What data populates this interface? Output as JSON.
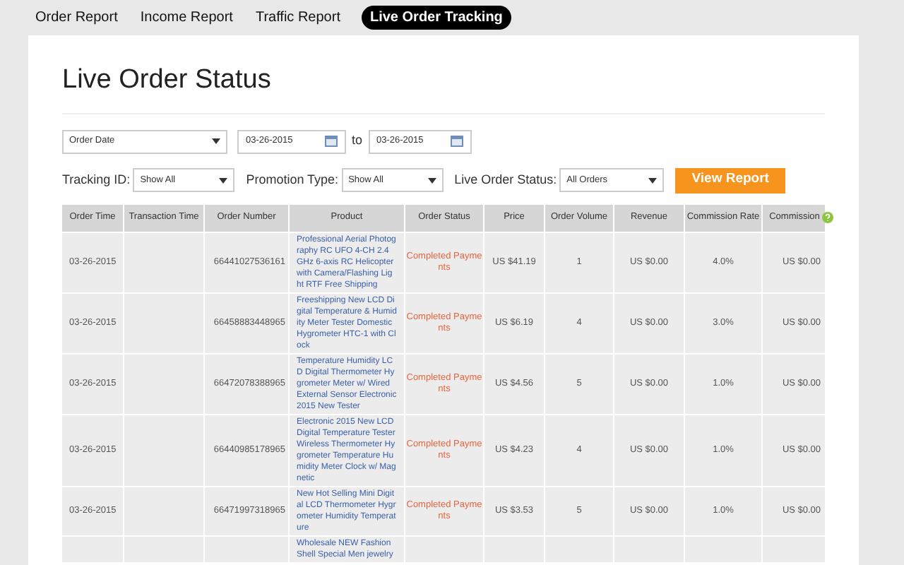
{
  "tabs": [
    {
      "label": "Order Report",
      "selected": false
    },
    {
      "label": "Income Report",
      "selected": false
    },
    {
      "label": "Traffic Report",
      "selected": false
    },
    {
      "label": "Live Order Tracking",
      "selected": true
    }
  ],
  "title": "Live Order Status",
  "date_filter": {
    "select": "Order Date",
    "from": "03-26-2015",
    "separator": "to",
    "to": "03-26-2015"
  },
  "filters": [
    {
      "label": "Tracking ID:",
      "value": "Show All"
    },
    {
      "label": "Promotion Type:",
      "value": "Show All"
    },
    {
      "label": "Live Order Status:",
      "value": "All Orders"
    }
  ],
  "view_button": "View Report",
  "table": {
    "columns": [
      "Order Time",
      "Transaction Time",
      "Order Number",
      "Product",
      "Order Status",
      "Price",
      "Order Volume",
      "Revenue",
      "Commission Rate",
      "Commission"
    ],
    "rows": [
      {
        "order_time": "03-26-2015",
        "order_number": "66441027536161",
        "product": "Professional Aerial Photography RC UFO 4-CH 2.4 GHz 6-axis RC Helicopter with Camera/Flashing Light RTF Free Shipping",
        "status": "Completed Payments",
        "price": "US $41.19",
        "volume": "1",
        "revenue": "US $0.00",
        "rate": "4.0%",
        "commission": "US $0.00"
      },
      {
        "order_time": "03-26-2015",
        "order_number": "66458883448965",
        "product": "Freeshipping New LCD Digital Temperature & Humidity Meter Tester Domestic Hygrometer HTC-1 with Clock",
        "status": "Completed Payments",
        "price": "US $6.19",
        "volume": "4",
        "revenue": "US $0.00",
        "rate": "3.0%",
        "commission": "US $0.00"
      },
      {
        "order_time": "03-26-2015",
        "order_number": "66472078388965",
        "product": "Temperature Humidity LCD Digital Thermometer Hygrometer Meter w/ Wired External Sensor Electronic 2015 New Tester",
        "status": "Completed Payments",
        "price": "US $4.56",
        "volume": "5",
        "revenue": "US $0.00",
        "rate": "1.0%",
        "commission": "US $0.00"
      },
      {
        "order_time": "03-26-2015",
        "order_number": "66440985178965",
        "product": "Electronic 2015 New LCD Digital Temperature Tester Wireless Thermometer Hygrometer Temperature Humidity Meter Clock w/ Magnetic",
        "status": "Completed Payments",
        "price": "US $4.23",
        "volume": "4",
        "revenue": "US $0.00",
        "rate": "1.0%",
        "commission": "US $0.00"
      },
      {
        "order_time": "03-26-2015",
        "order_number": "66471997318965",
        "product": "New Hot Selling Mini Digital LCD Thermometer Hygrometer Humidity Temperature",
        "status": "Completed Payments",
        "price": "US $3.53",
        "volume": "5",
        "revenue": "US $0.00",
        "rate": "1.0%",
        "commission": "US $0.00"
      },
      {
        "product": "Wholesale NEW Fashion Shell Special Men jewelry"
      }
    ]
  }
}
